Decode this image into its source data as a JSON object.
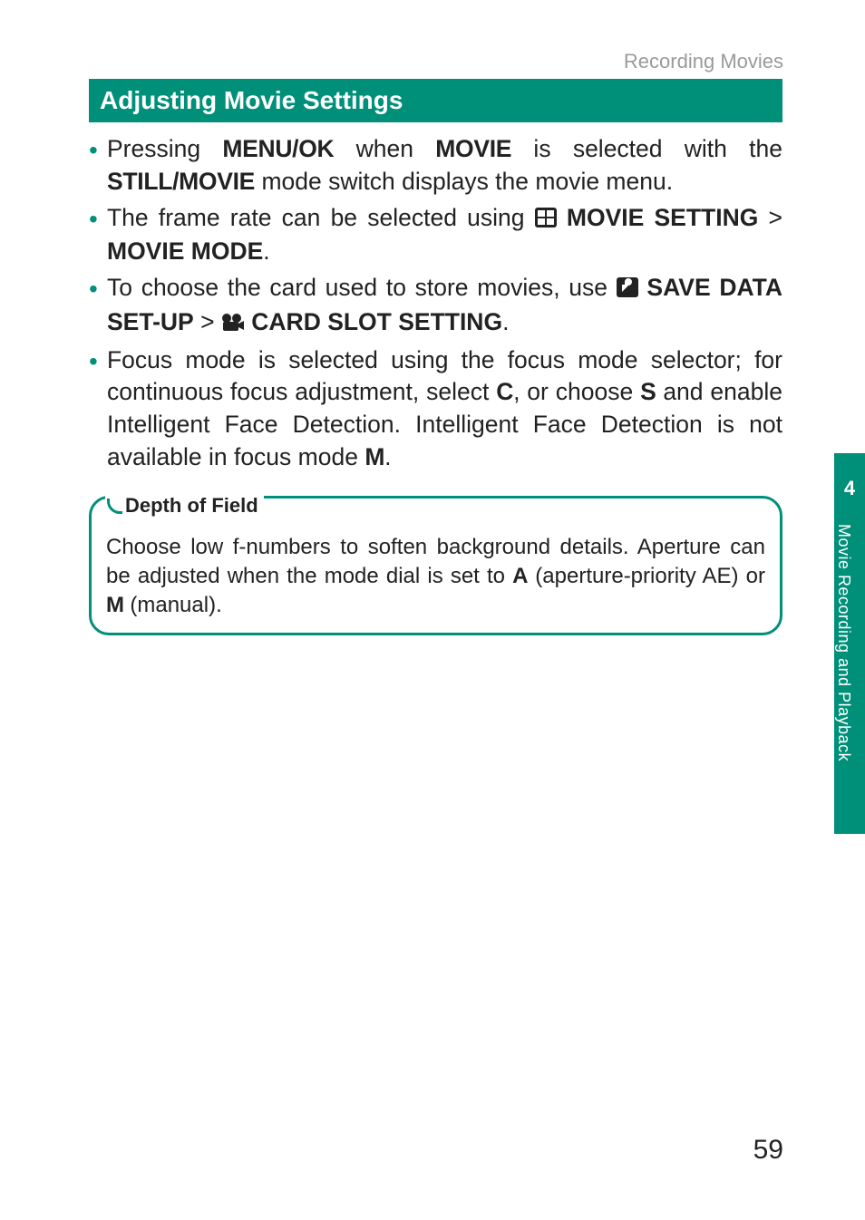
{
  "runningHead": "Recording Movies",
  "sectionTitle": "Adjusting Movie Settings",
  "bullets": {
    "b1": {
      "t1": "Pressing ",
      "k1": "MENU/OK",
      "t2": " when ",
      "k2": "MOVIE",
      "t3": " is selected with the ",
      "k3": "STILL/MOVIE",
      "t4": " mode switch displays the movie menu."
    },
    "b2": {
      "t1": "The frame rate can be selected using ",
      "k1": "MOVIE SETTING",
      "gt": " > ",
      "k2": "MOVIE MODE",
      "t2": "."
    },
    "b3": {
      "t1": "To choose the card used to store movies, use ",
      "k1": "SAVE DATA SET-UP",
      "gt": " > ",
      "k2": " CARD SLOT SETTING",
      "t2": "."
    },
    "b4": {
      "t1": "Focus mode is selected using the focus mode selector; for continuous focus adjustment, select ",
      "k1": "C",
      "t2": ", or choose ",
      "k2": "S",
      "t3": " and enable Intelligent Face Detection. Intelligent Face Detection is not available in focus mode ",
      "k3": "M",
      "t4": "."
    }
  },
  "callout": {
    "title": "Depth of Field",
    "t1": "Choose low f-numbers to soften background details. Aperture can be adjusted when the mode dial is set to ",
    "k1": "A",
    "t2": " (aperture-priority AE) or ",
    "k2": "M",
    "t3": " (manual)."
  },
  "sideTab": {
    "number": "4",
    "label": "Movie Recording and Playback"
  },
  "pageNumber": "59"
}
